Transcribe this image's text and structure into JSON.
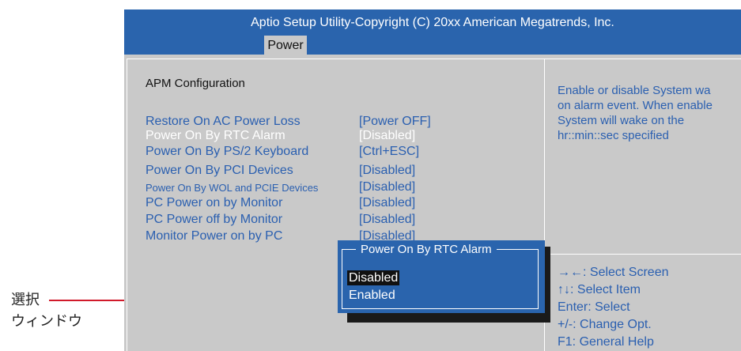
{
  "annotation": {
    "line1": "選択",
    "line2": "ウィンドウ"
  },
  "header": {
    "title": "Aptio Setup Utility-Copyright (C) 20xx American Megatrends, Inc.",
    "tab": "Power"
  },
  "section_title": "APM  Configuration",
  "items": [
    {
      "label": "Restore On AC Power Loss",
      "value": "[Power OFF]"
    },
    {
      "label": "Power On By RTC Alarm",
      "value": "[Disabled]"
    },
    {
      "label": "Power On By PS/2 Keyboard",
      "value": "[Ctrl+ESC]"
    },
    {
      "label": "Power On By PCI Devices",
      "value": "[Disabled]"
    },
    {
      "label": "Power On By WOL and PCIE Devices",
      "value": "[Disabled]"
    },
    {
      "label": "PC Power on by Monitor",
      "value": "[Disabled]"
    },
    {
      "label": "PC Power off by Monitor",
      "value": "[Disabled]"
    },
    {
      "label": "Monitor Power on by PC",
      "value": "[Disabled]"
    }
  ],
  "help": {
    "lines": [
      "Enable or disable System wa",
      "on alarm event. When enable",
      "System will wake on the",
      "hr::min::sec specified"
    ]
  },
  "keys": [
    "→←: Select Screen",
    "↑↓: Select Item",
    "Enter: Select",
    "+/-: Change Opt.",
    "F1: General Help"
  ],
  "popup": {
    "title": "Power On By RTC Alarm",
    "options": [
      "Disabled",
      "Enabled"
    ]
  }
}
